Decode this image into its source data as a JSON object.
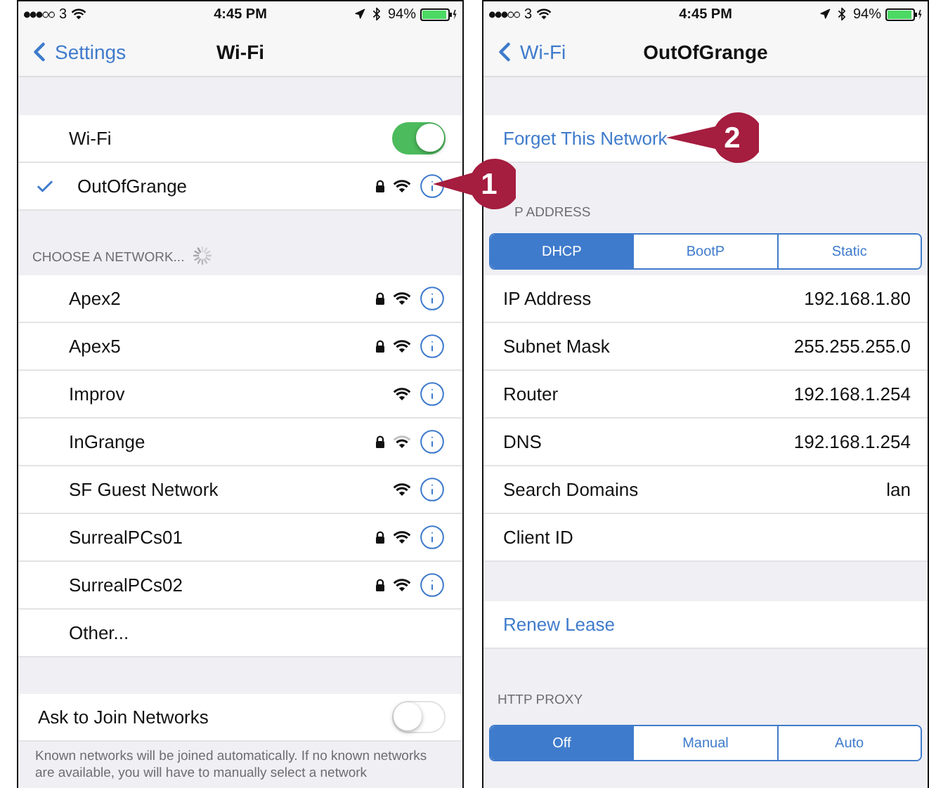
{
  "wifi_screen": {
    "status": {
      "carrier": "3",
      "time": "4:45 PM",
      "battery": "94%"
    },
    "nav": {
      "back": "Settings",
      "title": "Wi-Fi"
    },
    "wifi_toggle": {
      "label": "Wi-Fi",
      "on": true
    },
    "connected": {
      "name": "OutOfGrange",
      "checked": true,
      "locked": true
    },
    "section_header": "CHOOSE A NETWORK...",
    "networks": [
      {
        "name": "Apex2",
        "locked": true,
        "weak_signal": false
      },
      {
        "name": "Apex5",
        "locked": true,
        "weak_signal": false
      },
      {
        "name": "Improv",
        "locked": false,
        "weak_signal": false
      },
      {
        "name": "InGrange",
        "locked": true,
        "weak_signal": true
      },
      {
        "name": "SF Guest Network",
        "locked": false,
        "weak_signal": false
      },
      {
        "name": "SurrealPCs01",
        "locked": true,
        "weak_signal": false
      },
      {
        "name": "SurrealPCs02",
        "locked": true,
        "weak_signal": false
      }
    ],
    "other": "Other...",
    "ask_join": {
      "label": "Ask to Join Networks",
      "on": false
    },
    "footer": "Known networks will be joined automatically. If no known networks are available, you will have to manually select a network"
  },
  "detail_screen": {
    "status": {
      "carrier": "3",
      "time": "4:45 PM",
      "battery": "94%"
    },
    "nav": {
      "back": "Wi-Fi",
      "title": "OutOfGrange"
    },
    "forget": "Forget This Network",
    "ip_header": "P ADDRESS",
    "ip_modes": [
      {
        "label": "DHCP",
        "selected": true
      },
      {
        "label": "BootP",
        "selected": false
      },
      {
        "label": "Static",
        "selected": false
      }
    ],
    "fields": [
      {
        "label": "IP Address",
        "value": "192.168.1.80"
      },
      {
        "label": "Subnet Mask",
        "value": "255.255.255.0"
      },
      {
        "label": "Router",
        "value": "192.168.1.254"
      },
      {
        "label": "DNS",
        "value": "192.168.1.254"
      },
      {
        "label": "Search Domains",
        "value": "lan"
      },
      {
        "label": "Client ID"
      }
    ],
    "renew": "Renew Lease",
    "proxy_header": "HTTP PROXY",
    "proxy_modes": [
      {
        "label": "Off",
        "selected": true
      },
      {
        "label": "Manual",
        "selected": false
      },
      {
        "label": "Auto",
        "selected": false
      }
    ]
  },
  "callouts": [
    {
      "number": "1"
    },
    {
      "number": "2"
    }
  ]
}
